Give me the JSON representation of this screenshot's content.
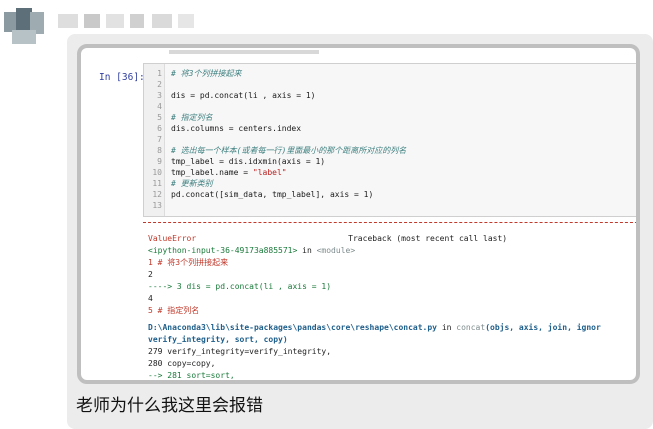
{
  "cell": {
    "prompt": "In  [36]:",
    "lines": [
      {
        "num": "1",
        "text": "# 将3个列拼接起来",
        "kind": "comment"
      },
      {
        "num": "2",
        "text": "",
        "kind": "code"
      },
      {
        "num": "3",
        "text": "dis = pd.concat(li , axis = 1)",
        "kind": "code"
      },
      {
        "num": "4",
        "text": "",
        "kind": "code"
      },
      {
        "num": "5",
        "text": "# 指定列名",
        "kind": "comment"
      },
      {
        "num": "6",
        "text": "dis.columns = centers.index",
        "kind": "code"
      },
      {
        "num": "7",
        "text": "",
        "kind": "code"
      },
      {
        "num": "8",
        "text": "# 选出每一个样本(或者每一行)里面最小的那个距离所对应的列名",
        "kind": "comment"
      },
      {
        "num": "9",
        "text": "tmp_label = dis.idxmin(axis = 1)",
        "kind": "code"
      },
      {
        "num": "10",
        "text": "tmp_label.name = \"label\"",
        "kind": "code"
      },
      {
        "num": "11",
        "text": "# 更新类别",
        "kind": "comment"
      },
      {
        "num": "12",
        "text": "pd.concat([sim_data, tmp_label], axis = 1)",
        "kind": "code"
      },
      {
        "num": "13",
        "text": "",
        "kind": "code"
      }
    ]
  },
  "traceback": {
    "error_name": "ValueError",
    "header": "Traceback (most recent call last)",
    "input_ref": "<ipython-input-36-49173a885571>",
    "in_word": "in",
    "module": "<module>",
    "ctx1": [
      "      1 # 将3个列拼接起来",
      "      2",
      "----> 3 dis = pd.concat(li , axis = 1)",
      "      4",
      "      5 # 指定列名"
    ],
    "file_path": "D:\\Anaconda3\\lib\\site-packages\\pandas\\core\\reshape\\concat.py",
    "func_name": "concat",
    "signature": "(objs, axis, join, ignor",
    "signature_cont": "verify_integrity, sort, copy)",
    "ctx2": [
      "    279         verify_integrity=verify_integrity,",
      "    280         copy=copy,",
      "--> 281         sort=sort,"
    ]
  },
  "caption": "老师为什么我这里会报错"
}
